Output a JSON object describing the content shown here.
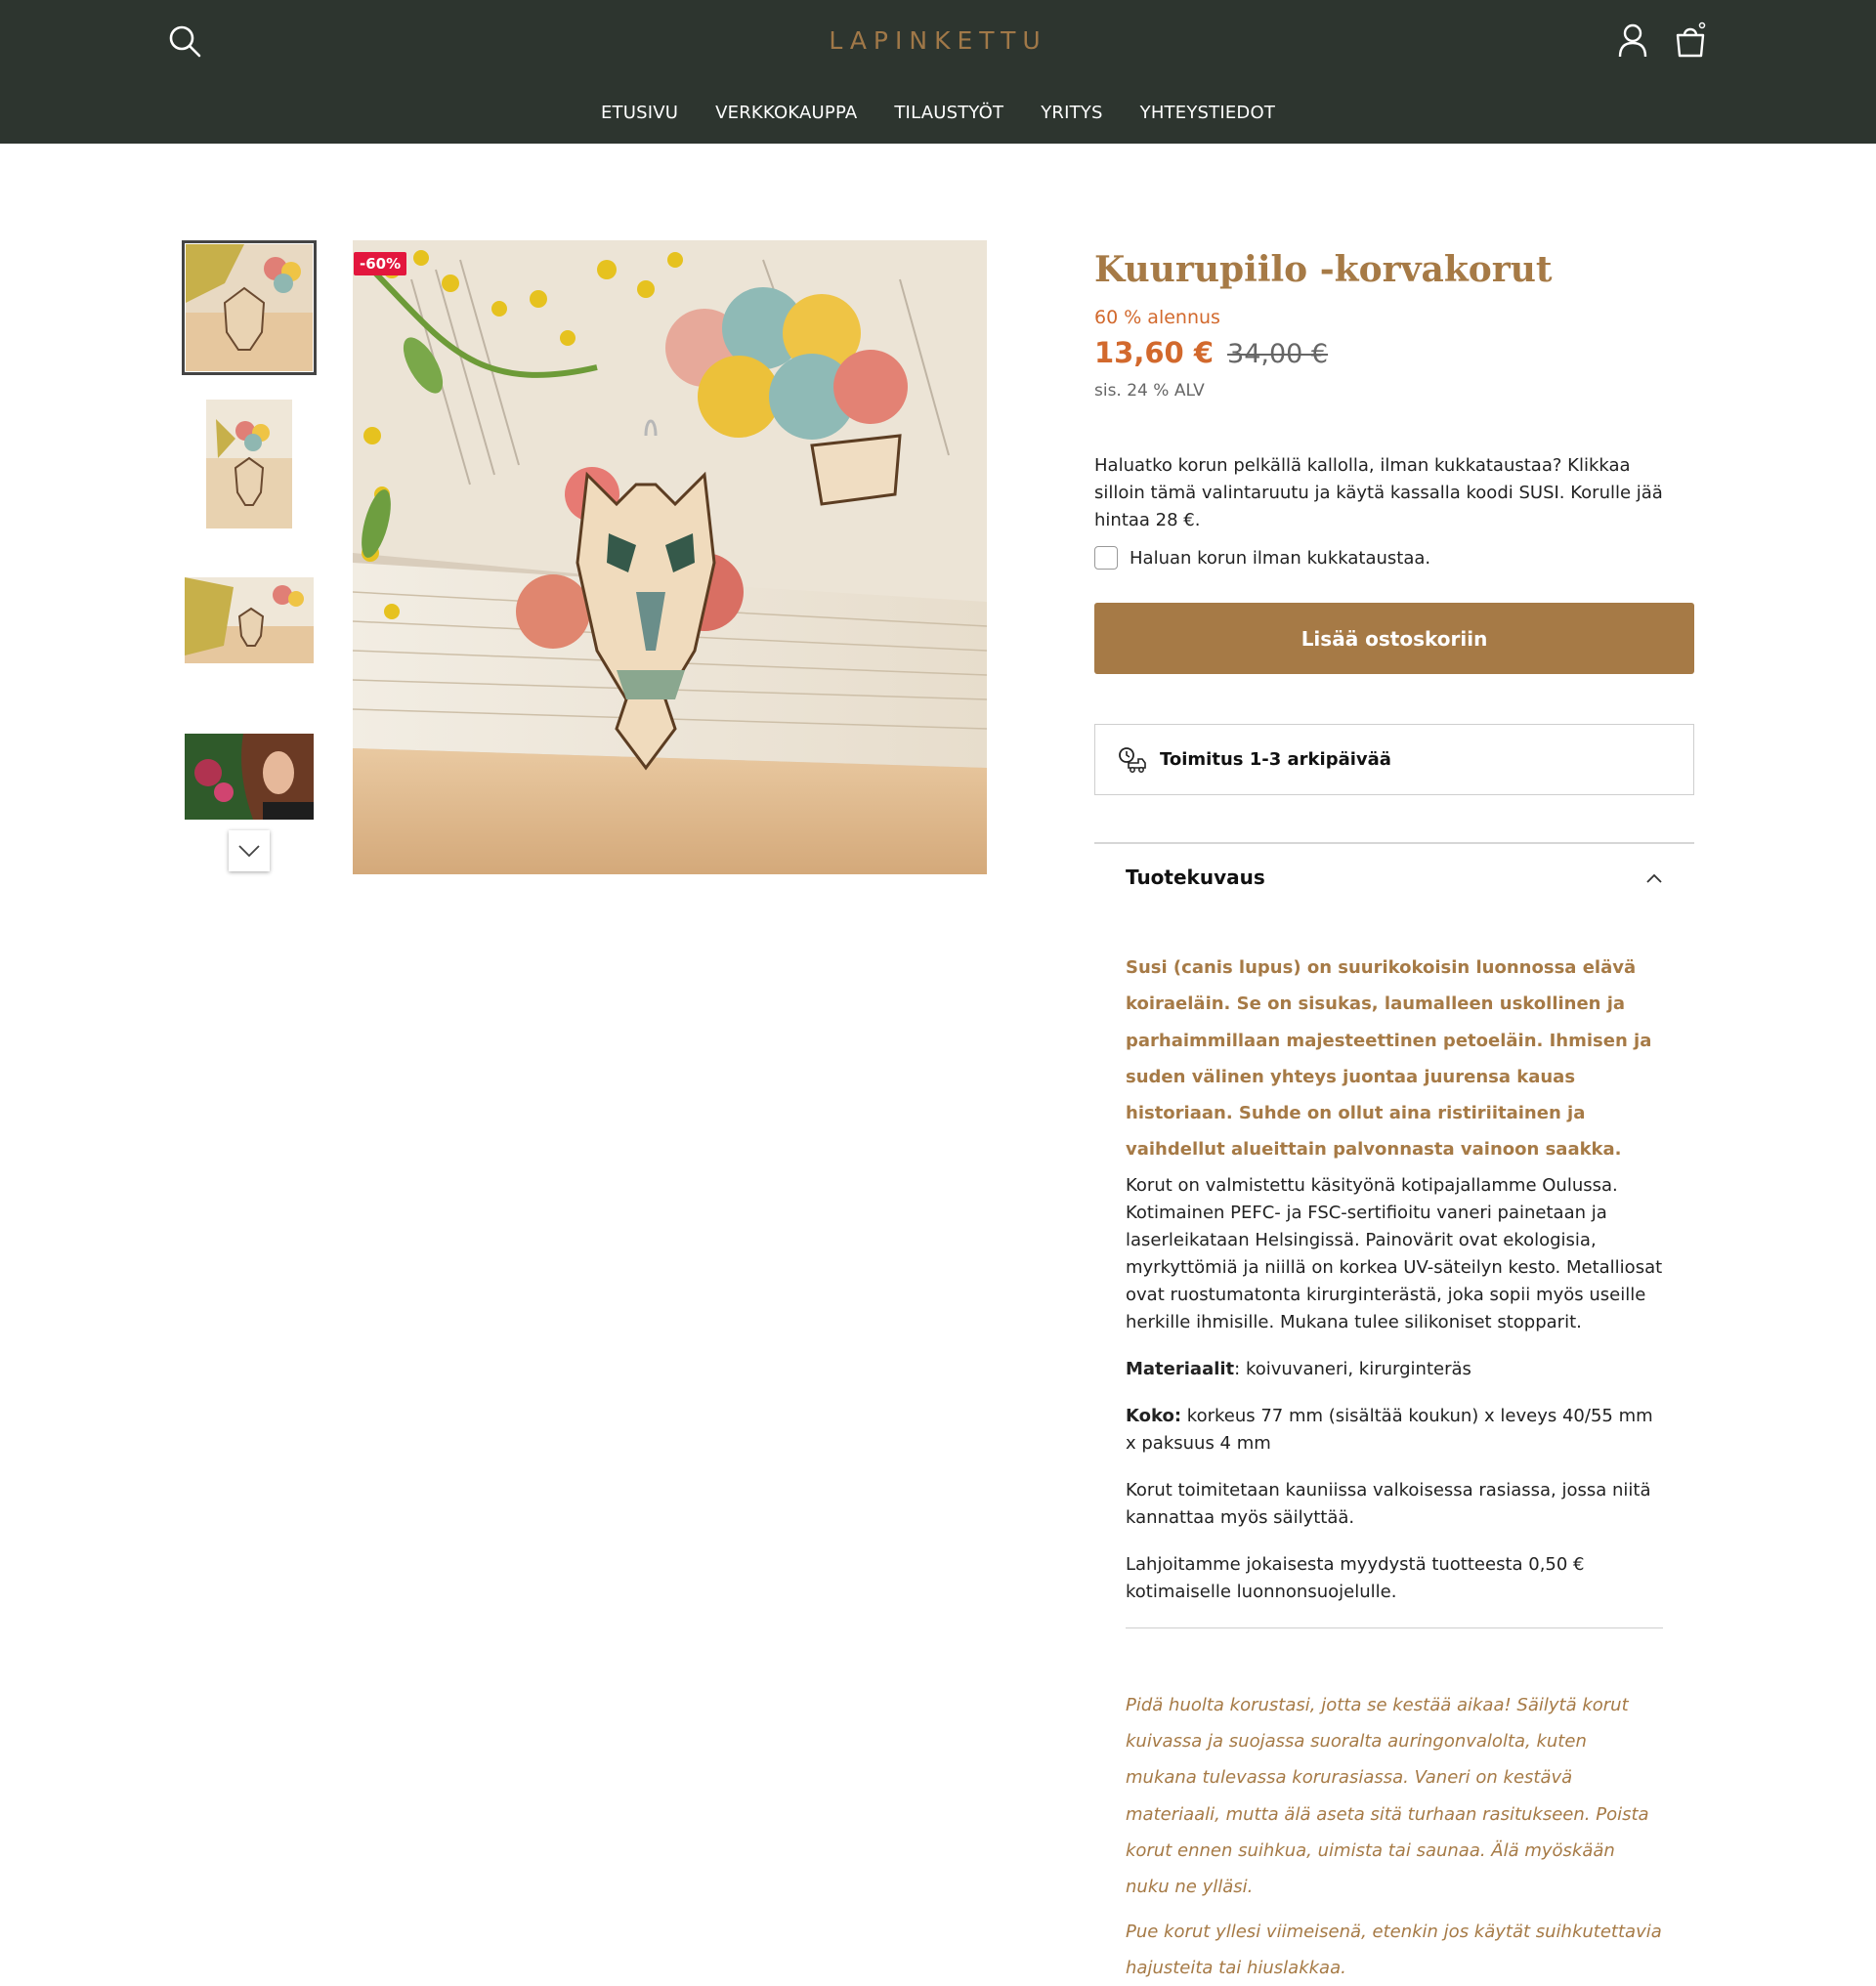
{
  "brand": {
    "logo": "LAPINKETTU",
    "header_color": "#2d352f",
    "accent_color": "#a67a46",
    "sale_color": "#e3163d"
  },
  "header": {
    "icons": [
      "search-icon",
      "user-icon",
      "shopping-bag-icon"
    ],
    "nav": [
      "ETUSIVU",
      "VERKKOKAUPPA",
      "TILAUSTYÖT",
      "YRITYS",
      "YHTEYSTIEDOT"
    ]
  },
  "gallery": {
    "badge": "-60%",
    "thumbnail_count": 4,
    "active_thumbnail": 1,
    "scroll_icon": "chevron-down-icon"
  },
  "product": {
    "title": "Kuurupiilo -korvakorut",
    "discount_label": "60 % alennus",
    "price": "13,60 €",
    "old_price": "34,00 €",
    "vat": "sis. 24 % ALV",
    "option_text": "Haluatko korun pelkällä kallolla, ilman kukkataustaa? Klikkaa silloin tämä valintaruutu ja käytä kassalla koodi SUSI. Korulle jää hintaa 28 €.",
    "checkbox_label": "Haluan korun ilman kukkataustaa.",
    "checkbox_checked": false,
    "add_to_cart": "Lisää ostoskoriin",
    "delivery": "Toimitus 1-3 arkipäivää",
    "delivery_icon": "delivery-truck-icon"
  },
  "description": {
    "heading": "Tuotekuvaus",
    "chevron": "chevron-up-icon",
    "lead": "Susi (canis lupus) on suurikokoisin luonnossa elävä koiraeläin. Se on sisukas, laumalleen uskollinen ja parhaimmillaan majesteettinen petoeläin. Ihmisen ja suden välinen yhteys juontaa juurensa kauas historiaan. Suhde on ollut aina ristiriitainen ja vaihdellut alueittain palvonnasta vainoon saakka.",
    "p1": "Korut on valmistettu käsityönä kotipajallamme Oulussa. Kotimainen PEFC- ja FSC-sertifioitu vaneri painetaan ja laserleikataan Helsingissä. Painovärit ovat ekologisia, myrkyttömiä ja niillä on korkea UV-säteilyn kesto. Metalliosat ovat ruostumatonta kirurginterästä, joka sopii myös useille herkille ihmisille. Mukana tulee silikoniset stopparit.",
    "materials_label": "Materiaalit",
    "materials_value": ": koivuvaneri, kirurginteräs",
    "size_label": "Koko:",
    "size_value": " korkeus 77 mm (sisältää koukun) x leveys 40/55 mm x paksuus 4 mm",
    "p_box": "Korut toimitetaan kauniissa valkoisessa rasiassa, jossa niitä kannattaa myös säilyttää.",
    "p_donation": "Lahjoitamme jokaisesta myydystä tuotteesta 0,50 € kotimaiselle luonnonsuojelulle.",
    "care1": "Pidä huolta korustasi, jotta se kestää aikaa! Säilytä korut kuivassa ja suojassa suoralta auringonvalolta, kuten mukana tulevassa korurasiassa. Vaneri on kestävä materiaali, mutta älä aseta sitä turhaan rasitukseen. Poista korut ennen suihkua, uimista tai saunaa. Älä myöskään nuku ne ylläsi.",
    "care2": "Pue korut yllesi viimeisenä, etenkin jos käytät suihkutettavia hajusteita tai hiuslakkaa."
  }
}
